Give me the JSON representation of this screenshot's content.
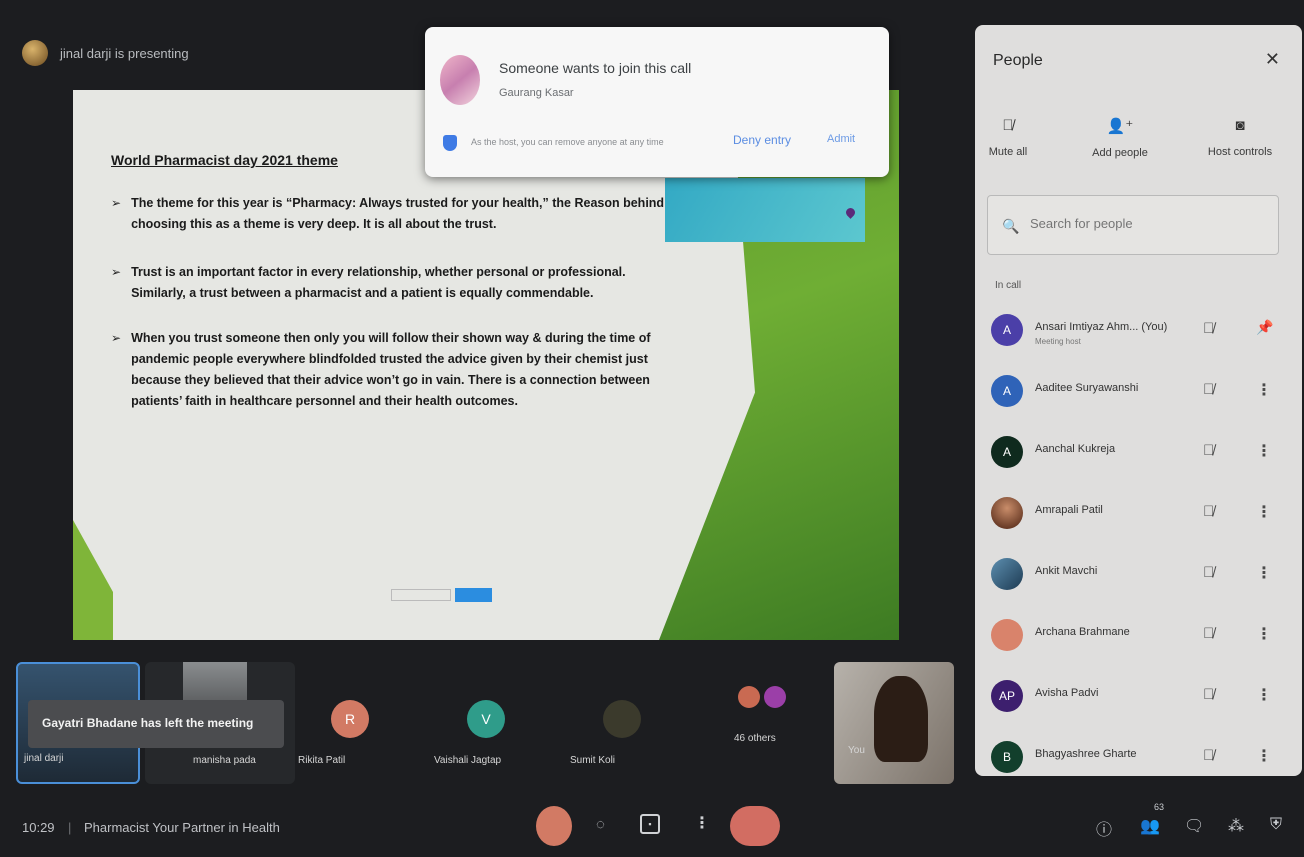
{
  "presenter": {
    "text": "jinal darji is presenting"
  },
  "slide": {
    "title": "World Pharmacist day 2021 theme",
    "bullets": [
      "The theme for this year is “Pharmacy: Always trusted for your health,” the Reason behind choosing this as a theme is very deep. It is all about the trust.",
      "Trust is an important factor in every relationship, whether personal or professional. Similarly, a trust between a pharmacist and a patient is equally commendable.",
      "When you trust someone then only you will follow their shown way & during the time of pandemic people everywhere blindfolded trusted the advice given by their chemist just because they believed that their advice won’t go in vain. There is a connection between patients’ faith in healthcare personnel and their health outcomes."
    ]
  },
  "join_request": {
    "title": "Someone wants to join this call",
    "name": "Gaurang Kasar",
    "note": "As the host, you can remove anyone at any time",
    "deny_label": "Deny entry",
    "admit_label": "Admit"
  },
  "people_panel": {
    "title": "People",
    "controls": [
      {
        "label": "Mute all",
        "icon": "mic-off-icon"
      },
      {
        "label": "Add people",
        "icon": "add-person-icon"
      },
      {
        "label": "Host controls",
        "icon": "host-controls-icon"
      }
    ],
    "search_placeholder": "Search for people",
    "section_label": "In call",
    "people": [
      {
        "name": "Ansari Imtiyaz Ahm...  (You)",
        "subtitle": "Meeting host",
        "initial": "A",
        "color": "#4b3fa8",
        "action": "pin"
      },
      {
        "name": "Aaditee Suryawanshi",
        "subtitle": "",
        "initial": "A",
        "color": "#2f63b8",
        "action": "more"
      },
      {
        "name": "Aanchal Kukreja",
        "subtitle": "",
        "initial": "A",
        "color": "#0f2a1e",
        "action": "more"
      },
      {
        "name": "Amrapali Patil",
        "subtitle": "",
        "initial": "",
        "color": "#5a2a18",
        "action": "more"
      },
      {
        "name": "Ankit Mavchi",
        "subtitle": "",
        "initial": "",
        "color": "#3b6e8f",
        "action": "more"
      },
      {
        "name": "Archana Brahmane",
        "subtitle": "",
        "initial": "",
        "color": "#d9836b",
        "action": "more"
      },
      {
        "name": "Avisha Padvi",
        "subtitle": "",
        "initial": "AP",
        "color": "#3d1f6e",
        "action": "more"
      },
      {
        "name": "Bhagyashree Gharte",
        "subtitle": "",
        "initial": "B",
        "color": "#123f2c",
        "action": "more"
      }
    ]
  },
  "tiles": [
    {
      "name": "jinal darji"
    },
    {
      "name": "manisha pada"
    },
    {
      "name": "Rikita Patil",
      "initial": "R"
    },
    {
      "name": "Vaishali Jagtap",
      "initial": "V"
    },
    {
      "name": "Sumit Koli"
    },
    {
      "name": "46 others"
    },
    {
      "name": "You"
    }
  ],
  "toast": {
    "text": "Gayatri Bhadane has left the meeting"
  },
  "bottom_bar": {
    "time": "10:29",
    "separator": "|",
    "meeting_title": "Pharmacist Your Partner in Health",
    "people_count": "63"
  }
}
